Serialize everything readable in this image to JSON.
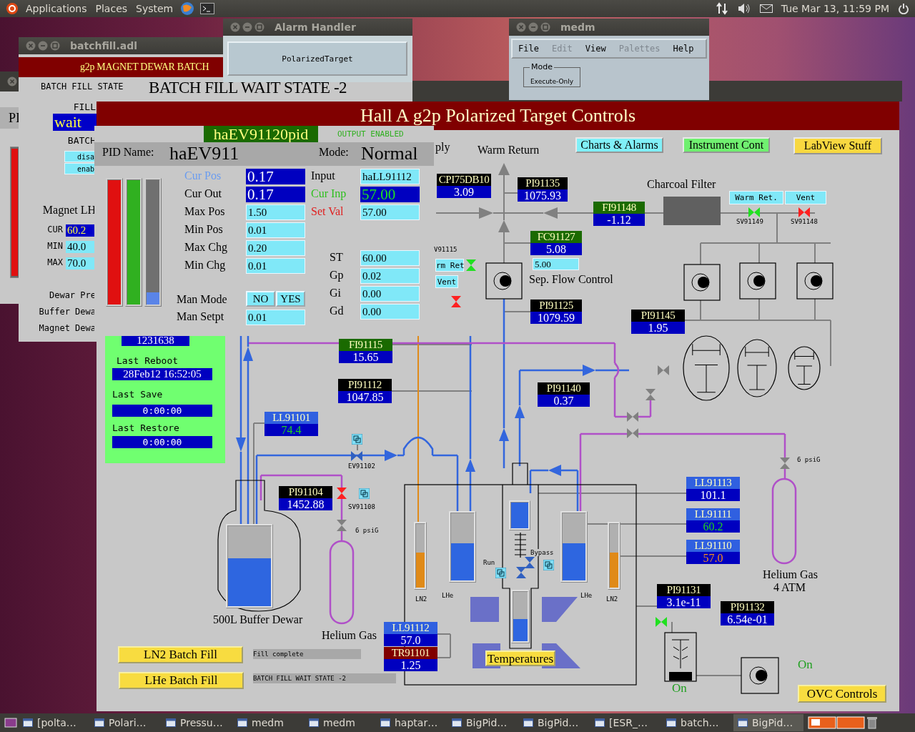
{
  "top_panel": {
    "menus": [
      "Applications",
      "Places",
      "System"
    ],
    "clock": "Tue Mar 13, 11:59 PM"
  },
  "back_window": {
    "label": "PI",
    "level": 1
  },
  "batchfill": {
    "title": "batchfill.adl",
    "banner": "g2p MAGNET DEWAR BATCH",
    "state_label": "BATCH FILL STATE",
    "state_value": "BATCH FILL WAIT STATE -2",
    "fill_label": "FILL",
    "fill_value": "wait",
    "batch_label": "BATCH",
    "buttons": [
      "disa",
      "enab"
    ],
    "magnet_label": "Magnet LH",
    "readings": [
      {
        "label": "CUR",
        "value": "60.2",
        "kind": "readback"
      },
      {
        "label": "MIN",
        "value": "40.0",
        "kind": "entry"
      },
      {
        "label": "MAX",
        "value": "70.0",
        "kind": "entry"
      }
    ],
    "notes": [
      "Dewar Pre",
      "Buffer Dewa",
      "Magnet Dewa"
    ]
  },
  "alarm_handler": {
    "title": "Alarm Handler",
    "group_button": "PolarizedTarget"
  },
  "medm": {
    "title": "medm",
    "menus": [
      {
        "label": "File",
        "disabled": false
      },
      {
        "label": "Edit",
        "disabled": true
      },
      {
        "label": "View",
        "disabled": false
      },
      {
        "label": "Palettes",
        "disabled": true
      },
      {
        "label": "Help",
        "disabled": false
      }
    ],
    "mode_label": "Mode",
    "mode_value": "Execute-Only"
  },
  "main": {
    "title": "Hall A g2p Polarized Target Controls",
    "nav_buttons": [
      {
        "label": "Charts & Alarms",
        "color": "#80f0f8"
      },
      {
        "label": "Instrument Cont",
        "color": "#70f070"
      },
      {
        "label": "LabView Stuff",
        "color": "#f8d840"
      }
    ],
    "labels": [
      {
        "text": "ply",
        "kind": "title"
      },
      {
        "text": "Warm Return",
        "kind": "title"
      },
      {
        "text": "Charcoal Filter",
        "kind": "title"
      },
      {
        "text": "Sep. Flow Control",
        "kind": "title"
      },
      {
        "text": "V91115",
        "kind": "small"
      },
      {
        "text": "SV91149",
        "kind": "small"
      },
      {
        "text": "SV91148",
        "kind": "small"
      },
      {
        "text": "EV91102",
        "kind": "small"
      },
      {
        "text": "SV91108",
        "kind": "small"
      },
      {
        "text": "6 psiG",
        "kind": "small"
      },
      {
        "text": "6 psiG",
        "kind": "small"
      },
      {
        "text": "Run",
        "kind": "small"
      },
      {
        "text": "Bypass",
        "kind": "small"
      },
      {
        "text": "LN2",
        "kind": "small"
      },
      {
        "text": "LHe",
        "kind": "small"
      },
      {
        "text": "LHe",
        "kind": "small"
      },
      {
        "text": "LN2",
        "kind": "small"
      },
      {
        "text": "500L Buffer Dewar",
        "kind": "title"
      },
      {
        "text": "Helium Gas",
        "kind": "title"
      },
      {
        "text": "Helium Gas",
        "kind": "title"
      },
      {
        "text": "4 ATM",
        "kind": "title"
      },
      {
        "text": "On",
        "kind": "status"
      },
      {
        "text": "On",
        "kind": "status"
      }
    ],
    "readouts": [
      {
        "name": "CPI75DB10",
        "value": "3.09",
        "color": "#000000",
        "kind": "normal"
      },
      {
        "name": "PI91135",
        "value": "1075.93",
        "color": "#000000",
        "kind": "normal"
      },
      {
        "name": "FI91148",
        "value": "-1.12",
        "color": "#1a6a00",
        "kind": "normal"
      },
      {
        "name": "FC91127",
        "value": "5.08",
        "color": "#1a6a00",
        "kind": "normal"
      },
      {
        "name": "PI91125",
        "value": "1079.59",
        "color": "#000000",
        "kind": "normal"
      },
      {
        "name": "PI91145",
        "value": "1.95",
        "color": "#000000",
        "kind": "normal"
      },
      {
        "name": "FI91115",
        "value": "15.65",
        "color": "#1a6a00",
        "kind": "normal"
      },
      {
        "name": "PI91112",
        "value": "1047.85",
        "color": "#000000",
        "kind": "normal"
      },
      {
        "name": "PI91140",
        "value": "0.37",
        "color": "#000000",
        "kind": "normal"
      },
      {
        "name": "LL91101",
        "value": "74.4",
        "color": "#3060e0",
        "kind": "ok"
      },
      {
        "name": "PI91104",
        "value": "1452.88",
        "color": "#000000",
        "kind": "normal"
      },
      {
        "name": "LL91113",
        "value": "101.1",
        "color": "#3060e0",
        "kind": "normal"
      },
      {
        "name": "LL91111",
        "value": "60.2",
        "color": "#3060e0",
        "kind": "ok"
      },
      {
        "name": "LL91110",
        "value": "57.0",
        "color": "#3060e0",
        "kind": "high"
      },
      {
        "name": "LL91112",
        "value": "57.0",
        "color": "#3060e0",
        "kind": "normal"
      },
      {
        "name": "TR91101",
        "value": "1.25",
        "color": "#800000",
        "kind": "normal"
      },
      {
        "name": "PI91131",
        "value": "3.1e-11",
        "color": "#000000",
        "kind": "normal"
      },
      {
        "name": "PI91132",
        "value": "6.54e-01",
        "color": "#000000",
        "kind": "normal"
      }
    ],
    "buttons": [
      {
        "label": "Warm Ret.",
        "kind": "small"
      },
      {
        "label": "Vent",
        "kind": "small"
      },
      {
        "label": "rm Ret",
        "kind": "small"
      },
      {
        "label": "Vent",
        "kind": "small"
      },
      {
        "label": "LN2 Batch Fill",
        "kind": "action"
      },
      {
        "label": "LHe Batch Fill",
        "kind": "action"
      },
      {
        "label": "Temperatures",
        "kind": "action"
      },
      {
        "label": "OVC Controls",
        "kind": "action"
      }
    ],
    "setpoint_field": {
      "value": "5.00"
    },
    "status_panel": {
      "counter": "1231638",
      "items": [
        {
          "label": "Last Reboot",
          "value": "28Feb12 16:52:05"
        },
        {
          "label": "Last Save",
          "value": "0:00:00"
        },
        {
          "label": "Last Restore",
          "value": "0:00:00"
        }
      ]
    },
    "messages": [
      "Fill complete",
      "BATCH FILL WAIT STATE -2"
    ],
    "gauges": [
      {
        "kind": "dewar",
        "level": 0.6
      },
      {
        "kind": "ln2",
        "level": 0.55
      },
      {
        "kind": "lhe",
        "level": 0.55
      },
      {
        "kind": "lhe",
        "level": 1
      },
      {
        "kind": "lhe",
        "level": 0.45
      },
      {
        "kind": "lhe",
        "level": 0.55
      },
      {
        "kind": "ln2",
        "level": 0.55
      }
    ]
  },
  "pid": {
    "pv": "haEV91120pid",
    "output": "OUTPUT ENABLED",
    "name_label": "PID Name:",
    "name": "haEV911",
    "mode_label": "Mode:",
    "mode": "Normal",
    "bars": [
      {
        "color": "#e01010",
        "level": 1
      },
      {
        "color": "#30b020",
        "level": 1
      },
      {
        "color": "#5a84e8",
        "level": 0.1
      }
    ],
    "left_fields": [
      {
        "label": "Cur Pos",
        "value": "0.17",
        "kind": "readback",
        "color": "#6a9cf0"
      },
      {
        "label": "Cur Out",
        "value": "0.17",
        "kind": "readback",
        "color": "#000000"
      },
      {
        "label": "Max Pos",
        "value": "1.50",
        "kind": "entry",
        "color": "#000000"
      },
      {
        "label": "Min Pos",
        "value": "0.01",
        "kind": "entry",
        "color": "#000000"
      },
      {
        "label": "Max Chg",
        "value": "0.20",
        "kind": "entry",
        "color": "#000000"
      },
      {
        "label": "Min Chg",
        "value": "0.01",
        "kind": "entry",
        "color": "#000000"
      }
    ],
    "right_fields": [
      {
        "label": "Input",
        "value": "haLL91112",
        "kind": "entry",
        "color": "#000000"
      },
      {
        "label": "Cur Inp",
        "value": "57.00",
        "kind": "monitor",
        "color": "#30c020"
      },
      {
        "label": "Set Val",
        "value": "57.00",
        "kind": "entry",
        "color": "#e02020"
      },
      {
        "label": "ST",
        "value": "60.00",
        "kind": "entry",
        "color": "#000000"
      },
      {
        "label": "Gp",
        "value": "0.02",
        "kind": "entry",
        "color": "#000000"
      },
      {
        "label": "Gi",
        "value": "0.00",
        "kind": "entry",
        "color": "#000000"
      },
      {
        "label": "Gd",
        "value": "0.00",
        "kind": "entry",
        "color": "#000000"
      }
    ],
    "man_mode": {
      "label": "Man Mode",
      "options": [
        "NO",
        "YES"
      ]
    },
    "man_setpt": {
      "label": "Man Setpt",
      "value": "0.01"
    }
  },
  "taskbar": [
    {
      "label": "[polta…",
      "selected": false
    },
    {
      "label": "Polari…",
      "selected": false
    },
    {
      "label": "Pressu…",
      "selected": false
    },
    {
      "label": "medm",
      "selected": false
    },
    {
      "label": "medm",
      "selected": false
    },
    {
      "label": "haptar…",
      "selected": false
    },
    {
      "label": "BigPid…",
      "selected": false
    },
    {
      "label": "BigPid…",
      "selected": false
    },
    {
      "label": "[ESR_…",
      "selected": false
    },
    {
      "label": "batch…",
      "selected": false
    },
    {
      "label": "BigPid…",
      "selected": true
    }
  ]
}
